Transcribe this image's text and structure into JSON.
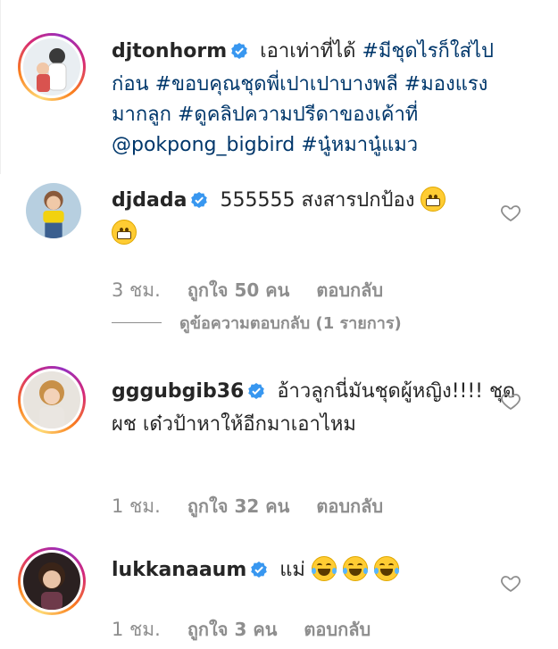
{
  "post": {
    "username": "djtonhorm",
    "text": "เอาเท่าที่ได้",
    "hashtags": [
      "#มีชุดไรก็ใส่ไปก่อน",
      "#ขอบคุณชุดพี่เปาเปาบางพลี",
      "#มองแรงมากลูก",
      "#ดูคลิปความปรีดาของเค้าที่"
    ],
    "mention": "@pokpong_bigbird",
    "last_hashtag": "#นู๋หมานู๋แมว"
  },
  "comments": [
    {
      "username": "djdada",
      "text": "555555 สงสารปกป้อง",
      "emoji": [
        "grinning-face",
        "grinning-face"
      ],
      "time": "3 ชม.",
      "likes": "ถูกใจ 50 คน",
      "reply_label": "ตอบกลับ",
      "view_replies": "ดูข้อความตอบกลับ (1 รายการ)"
    },
    {
      "username": "gggubgib36",
      "text": "อ้าวลูกนี่มันชุดผู้หญิง!!!! ชุดผช เด๋วป้าหาให้อีกมาเอาไหม",
      "time": "1 ชม.",
      "likes": "ถูกใจ 32 คน",
      "reply_label": "ตอบกลับ"
    },
    {
      "username": "lukkanaaum",
      "text": "แม่",
      "emoji": [
        "rolling-laughing-face",
        "rolling-laughing-face",
        "rolling-laughing-face"
      ],
      "time": "1 ชม.",
      "likes": "ถูกใจ 3 คน",
      "reply_label": "ตอบกลับ"
    }
  ],
  "colors": {
    "text": "#262626",
    "link": "#00376b",
    "meta": "#8e8e8e",
    "verified": "#3897f0",
    "story_ring_start": "#feda75",
    "story_ring_end": "#962fbf"
  }
}
